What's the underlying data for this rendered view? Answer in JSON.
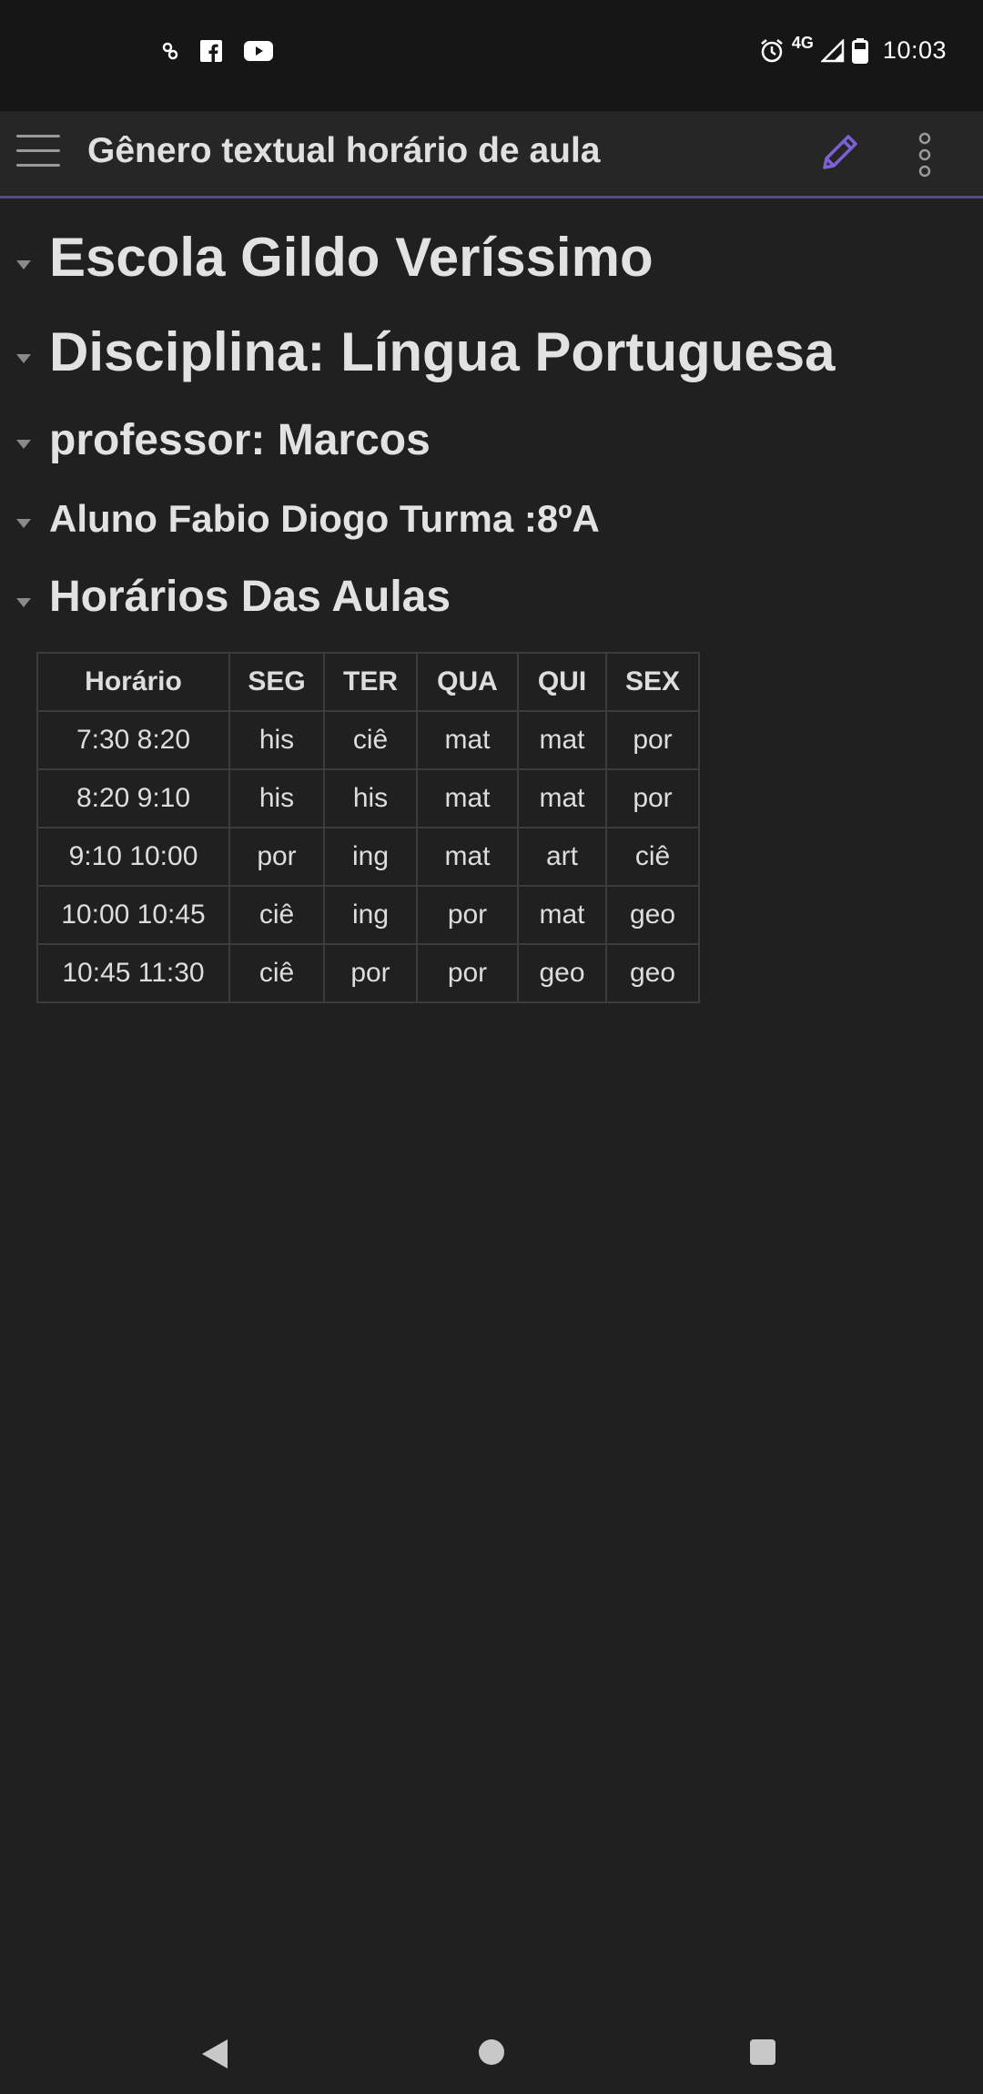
{
  "status_bar": {
    "time": "10:03",
    "network": "4G",
    "left_icons": [
      "app-notification-icon",
      "facebook-icon",
      "youtube-icon"
    ],
    "right_icons": [
      "alarm-icon",
      "signal-icon",
      "battery-icon"
    ]
  },
  "app_bar": {
    "title": "Gênero textual horário de aula",
    "accent_color": "#7b61d6"
  },
  "headings": [
    {
      "text": "Escola Gildo Veríssimo",
      "level": 1
    },
    {
      "text": "Disciplina: Língua Portuguesa",
      "level": 1
    },
    {
      "text": "professor: Marcos",
      "level": 2
    },
    {
      "text": "Aluno Fabio Diogo Turma :8ºA",
      "level": 3
    },
    {
      "text": "Horários Das Aulas",
      "level": 2
    }
  ],
  "table": {
    "headers": [
      "Horário",
      "SEG",
      "TER",
      "QUA",
      "QUI",
      "SEX"
    ],
    "rows": [
      [
        "7:30 8:20",
        "his",
        "ciê",
        "mat",
        "mat",
        "por"
      ],
      [
        "8:20 9:10",
        "his",
        "his",
        "mat",
        "mat",
        "por"
      ],
      [
        "9:10 10:00",
        "por",
        "ing",
        "mat",
        "art",
        "ciê"
      ],
      [
        "10:00 10:45",
        "ciê",
        "ing",
        "por",
        "mat",
        "geo"
      ],
      [
        "10:45 11:30",
        "ciê",
        "por",
        "por",
        "geo",
        "geo"
      ]
    ]
  },
  "nav_bar": {
    "icons": [
      "back-icon",
      "home-icon",
      "recents-icon"
    ]
  }
}
